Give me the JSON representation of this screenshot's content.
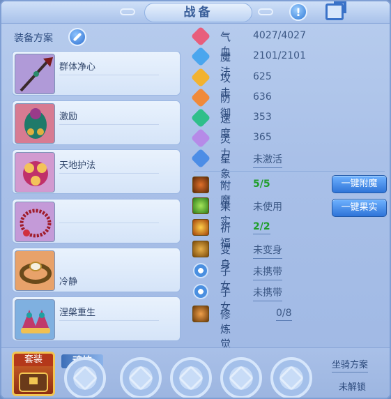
{
  "window": {
    "title": "战备",
    "help_icon": "exclamation-icon",
    "share_icon": "share-icon"
  },
  "left": {
    "scheme_label": "装备方案",
    "edit_icon": "pencil-icon",
    "slots": [
      {
        "name": "群体净心",
        "icon": "halberd-icon"
      },
      {
        "name": "激励",
        "icon": "armor-vest-icon"
      },
      {
        "name": "天地护法",
        "icon": "flower-helmet-icon"
      },
      {
        "name": "",
        "icon": "necklace-icon"
      },
      {
        "name": "冷静",
        "icon": "bracelet-icon"
      },
      {
        "name": "涅槃重生",
        "icon": "shoes-icon"
      }
    ]
  },
  "stats": [
    {
      "label": "气血",
      "value": "4027/4027",
      "icon": "heart-gem-icon",
      "color": "#e85e7c"
    },
    {
      "label": "魔法",
      "value": "2101/2101",
      "icon": "diamond-gem-icon",
      "color": "#4aa6ee"
    },
    {
      "label": "攻击",
      "value": "625",
      "icon": "sword-gem-icon",
      "color": "#f2b230"
    },
    {
      "label": "防御",
      "value": "636",
      "icon": "shield-gem-icon",
      "color": "#f08a3a"
    },
    {
      "label": "速度",
      "value": "353",
      "icon": "lightning-gem-icon",
      "color": "#2fbf8a"
    },
    {
      "label": "灵力",
      "value": "365",
      "icon": "spirit-gem-icon",
      "color": "#b68ae8"
    },
    {
      "label": "星象",
      "value": "未激活",
      "icon": "star-gem-icon",
      "color": "#4c8de6"
    }
  ],
  "extras": [
    {
      "label": "附魔",
      "value": "5/5",
      "icon": "enchant-icon",
      "green": true
    },
    {
      "label": "果实",
      "value": "未使用",
      "icon": "fruit-icon",
      "green": false
    },
    {
      "label": "祈福",
      "value": "2/2",
      "icon": "blessing-icon",
      "green": true
    },
    {
      "label": "变身",
      "value": "未变身",
      "icon": "transform-icon",
      "green": false
    },
    {
      "label": "子女",
      "value": "未携带",
      "icon": "paw-icon",
      "green": false
    },
    {
      "label": "子女",
      "value": "未携带",
      "icon": "paw-icon",
      "green": false
    },
    {
      "label": "修炼觉醒",
      "value": "0/8",
      "icon": "cultivation-icon",
      "green": false
    }
  ],
  "buttons": {
    "attach_all": "一键附魔",
    "fruit_all": "一键果实"
  },
  "bottom": {
    "suit_label": "套装",
    "soul_label": "魂技",
    "mount_label": "坐骑方案",
    "mount_status": "未解锁"
  }
}
